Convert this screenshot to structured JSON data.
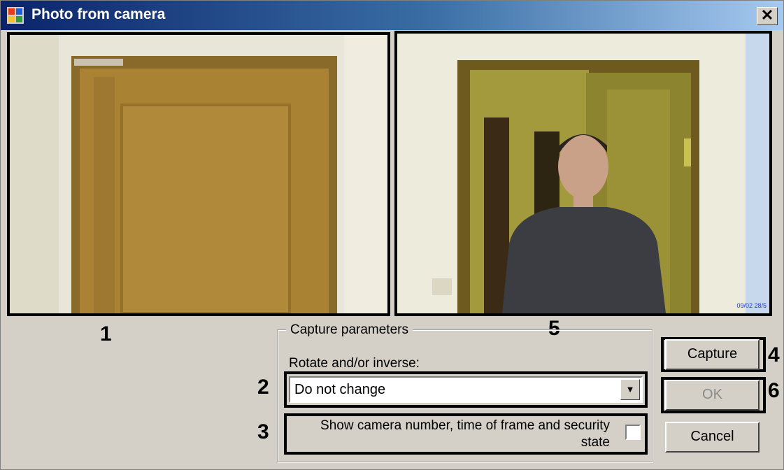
{
  "window": {
    "title": "Photo from camera",
    "close_label": "✕"
  },
  "callouts": {
    "n1": "1",
    "n2": "2",
    "n3": "3",
    "n4": "4",
    "n5": "5",
    "n6": "6"
  },
  "capture_params": {
    "group_label": "Capture parameters",
    "rotate_label": "Rotate and/or inverse:",
    "rotate_value": "Do not change",
    "show_info_label_line1": "Show camera number, time of frame and security",
    "show_info_label_line2": "state",
    "show_info_checked": false
  },
  "buttons": {
    "capture": "Capture",
    "ok": "OK",
    "cancel": "Cancel"
  },
  "preview": {
    "timestamp": "09/02 28/5"
  },
  "icons": {
    "app": "window-app-icon",
    "close": "close-icon",
    "dropdown": "chevron-down-icon"
  }
}
